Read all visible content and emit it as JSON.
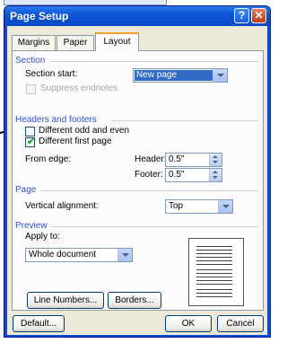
{
  "window": {
    "title": "Page Setup",
    "help": "?",
    "close": "✕"
  },
  "tabs": [
    {
      "label": "Margins"
    },
    {
      "label": "Paper"
    },
    {
      "label": "Layout"
    }
  ],
  "section": {
    "heading": "Section",
    "start_label": "Section start:",
    "start_value": "New page",
    "suppress_label": "Suppress endnotes"
  },
  "headers_footers": {
    "heading": "Headers and footers",
    "odd_even_label": "Different odd and even",
    "first_page_label": "Different first page",
    "odd_even_checked": false,
    "first_page_checked": true,
    "from_edge_label": "From edge:",
    "header_label": "Header:",
    "header_value": "0.5\"",
    "footer_label": "Footer:",
    "footer_value": "0.5\""
  },
  "page": {
    "heading": "Page",
    "valign_label": "Vertical alignment:",
    "valign_value": "Top"
  },
  "preview": {
    "heading": "Preview",
    "apply_label": "Apply to:",
    "apply_value": "Whole document"
  },
  "buttons": {
    "line_numbers": "Line Numbers...",
    "borders": "Borders...",
    "default": "Default...",
    "ok": "OK",
    "cancel": "Cancel"
  },
  "colors": {
    "title_bar": "#0a4fd6",
    "group_heading": "#2f55cb",
    "dialog_bg": "#ece9d8"
  }
}
